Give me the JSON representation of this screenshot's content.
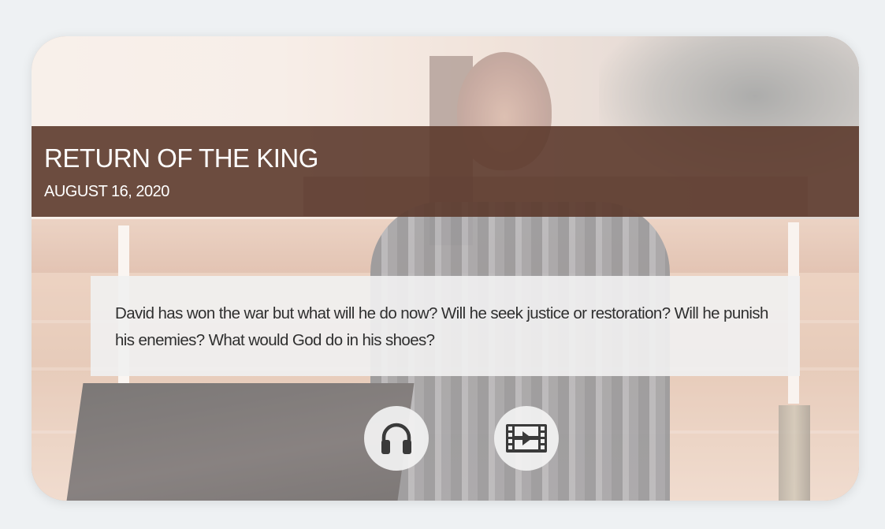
{
  "sermon": {
    "title": "RETURN OF THE KING",
    "date": "AUGUST 16, 2020",
    "description": "David has won the war but what will he do now? Will he seek justice or restoration? Will he punish his enemies? What would God do in his shoes?"
  },
  "media": {
    "audio_icon": "headphones-icon",
    "video_icon": "film-icon"
  },
  "colors": {
    "title_band": "#5c3a2c",
    "text_dark": "#2f2f2f",
    "icon": "#3a3a3a",
    "page_bg": "#eef1f3"
  }
}
